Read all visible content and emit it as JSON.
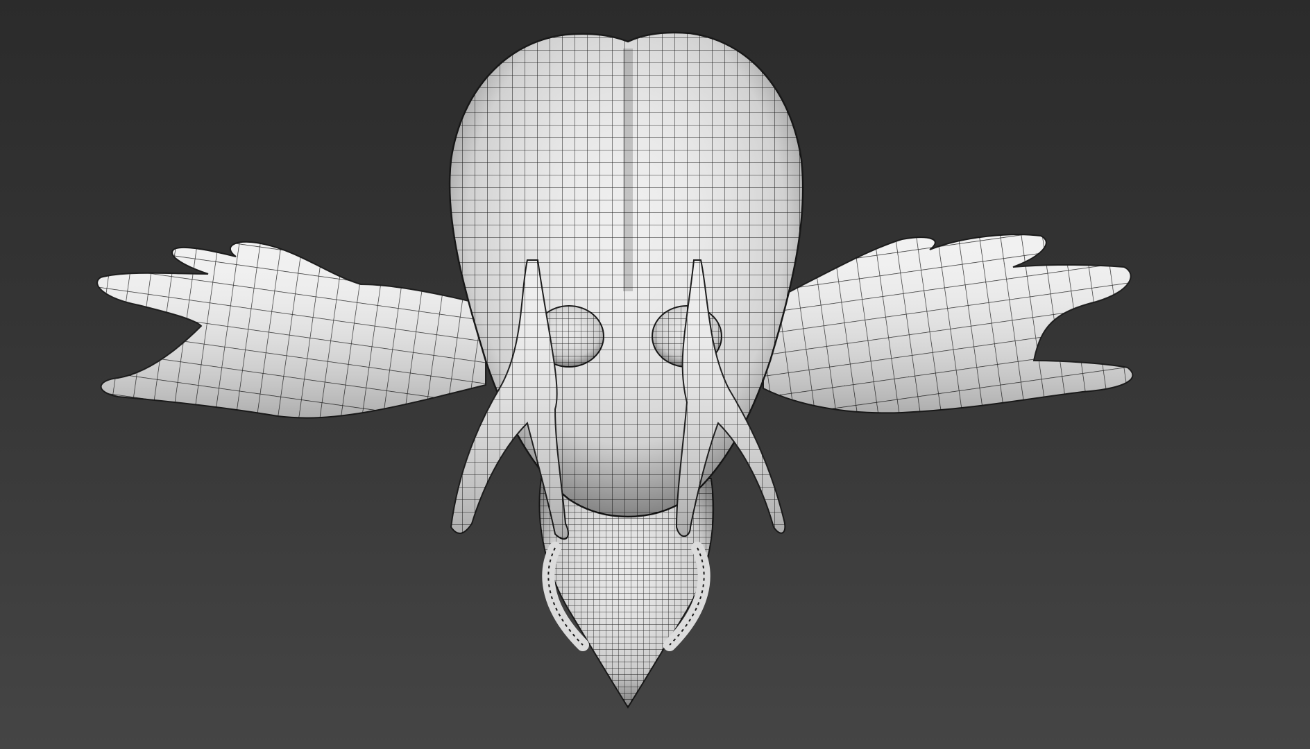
{
  "viewport": {
    "shading": "wireframe-on-shaded",
    "background_top": "#2b2b2b",
    "background_bottom": "#454545",
    "mesh_color": "#f2f2f2",
    "wire_color": "#1a1a1a"
  },
  "model": {
    "icon": "creature-head-mesh",
    "parts": [
      "cranium",
      "left-fin",
      "right-fin",
      "left-eye-stalk",
      "right-eye-stalk",
      "snout"
    ]
  }
}
